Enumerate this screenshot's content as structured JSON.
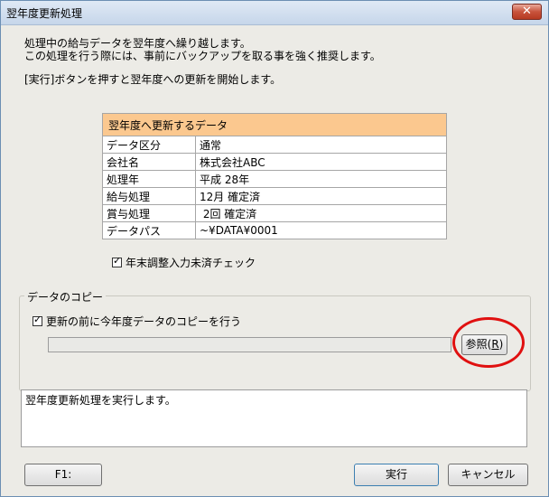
{
  "window": {
    "title": "翌年度更新処理",
    "close_icon": "close-icon"
  },
  "intro": {
    "line1": "処理中の給与データを翌年度へ繰り越します。",
    "line2": "この処理を行う際には、事前にバックアップを取る事を強く推奨します。",
    "line3": "[実行]ボタンを押すと翌年度への更新を開始します。"
  },
  "info_table": {
    "header": "翌年度へ更新するデータ",
    "rows": [
      {
        "label": "データ区分",
        "value": "通常"
      },
      {
        "label": "会社名",
        "value": "株式会社ABC"
      },
      {
        "label": "処理年",
        "value": "平成 28年"
      },
      {
        "label": "給与処理",
        "value": "12月 確定済"
      },
      {
        "label": "賞与処理",
        "value": " 2回 確定済"
      },
      {
        "label": "データパス",
        "value": "~¥DATA¥0001"
      }
    ]
  },
  "year_end_check": {
    "label": "年末調整入力未済チェック",
    "checked": true
  },
  "copy_group": {
    "title": "データのコピー",
    "checkbox_label": "更新の前に今年度データのコピーを行う",
    "checked": true,
    "path_value": "",
    "browse_label": "参照(",
    "browse_key": "R",
    "browse_close": ")"
  },
  "log": {
    "text": "翌年度更新処理を実行します。"
  },
  "buttons": {
    "f1": "F1:",
    "execute": "実行",
    "cancel": "キャンセル"
  },
  "colors": {
    "header_bg": "#fbc88f",
    "annotation": "#e01010"
  }
}
